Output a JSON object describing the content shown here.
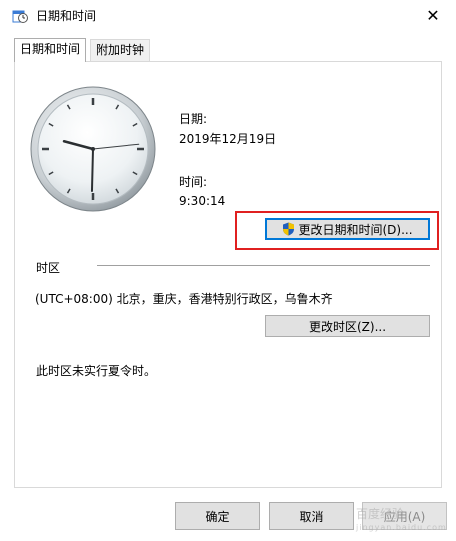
{
  "window": {
    "title": "日期和时间",
    "close_symbol": "✕",
    "icon": "clock-calendar-icon"
  },
  "tabs": [
    {
      "label": "日期和时间",
      "active": true
    },
    {
      "label": "附加时钟",
      "active": false
    }
  ],
  "datetime": {
    "date_label": "日期:",
    "date_value": "2019年12月19日",
    "time_label": "时间:",
    "time_value": "9:30:14",
    "change_button": "更改日期和时间(D)...",
    "clock": {
      "hour": 9,
      "minute": 30,
      "second": 14
    }
  },
  "timezone": {
    "section_label": "时区",
    "value": "(UTC+08:00) 北京，重庆，香港特别行政区，乌鲁木齐",
    "change_button": "更改时区(Z)...",
    "dst_note": "此时区未实行夏令时。"
  },
  "dialog_buttons": {
    "ok": "确定",
    "cancel": "取消",
    "apply": "应用(A)"
  },
  "watermark": {
    "brand": "百度经验",
    "url": "jingyan.baidu.com"
  },
  "colors": {
    "highlight": "#e02020",
    "focus": "#0078d7",
    "shield_blue": "#1f5fbf",
    "shield_yellow": "#f2c200"
  }
}
